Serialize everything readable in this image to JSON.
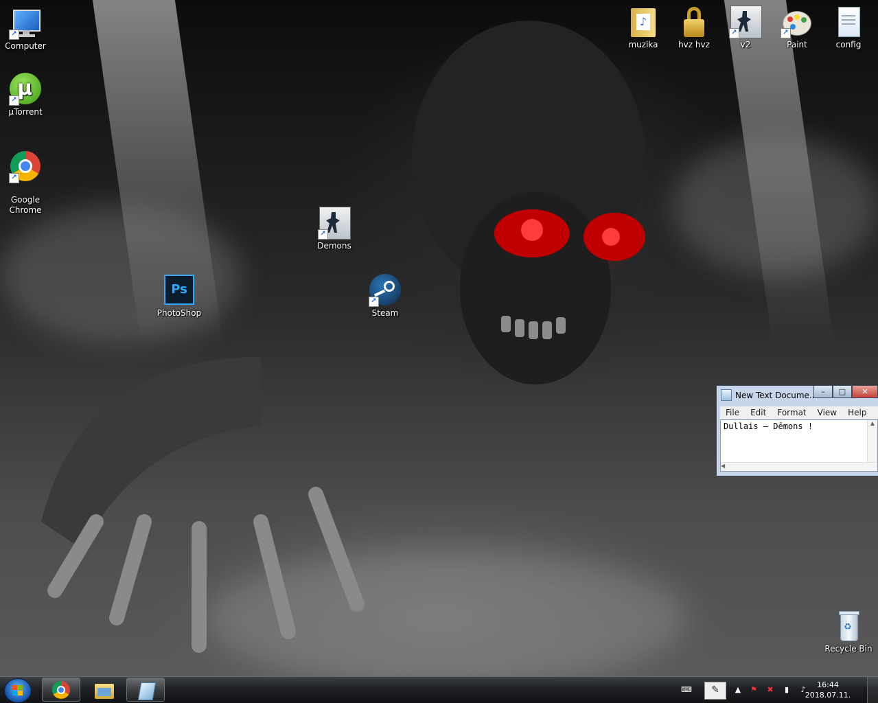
{
  "desktop": {
    "icons": [
      {
        "label": "Computer"
      },
      {
        "label": "µTorrent"
      },
      {
        "label": "Google\nChrome"
      },
      {
        "label": "Demons"
      },
      {
        "label": "PhotoShop"
      },
      {
        "label": "Steam"
      },
      {
        "label": "muzika"
      },
      {
        "label": "hvz hvz"
      },
      {
        "label": "v2"
      },
      {
        "label": "Paint"
      },
      {
        "label": "config"
      },
      {
        "label": "Recycle Bin"
      }
    ]
  },
  "notepad": {
    "title": "New Text Docume...",
    "menu": [
      "File",
      "Edit",
      "Format",
      "View",
      "Help"
    ],
    "content": "Dullais – Dēmons !",
    "buttons": {
      "minimize": "–",
      "maximize": "□",
      "close": "✕"
    }
  },
  "taskbar": {
    "clock_time": "16:44",
    "clock_date": "2018.07.11.",
    "tray_expand": "▲"
  },
  "colors": {
    "taskbar": "#1d1f23",
    "eyes": "#ff1a1a",
    "notepad_frame": "#c7d6ea"
  }
}
